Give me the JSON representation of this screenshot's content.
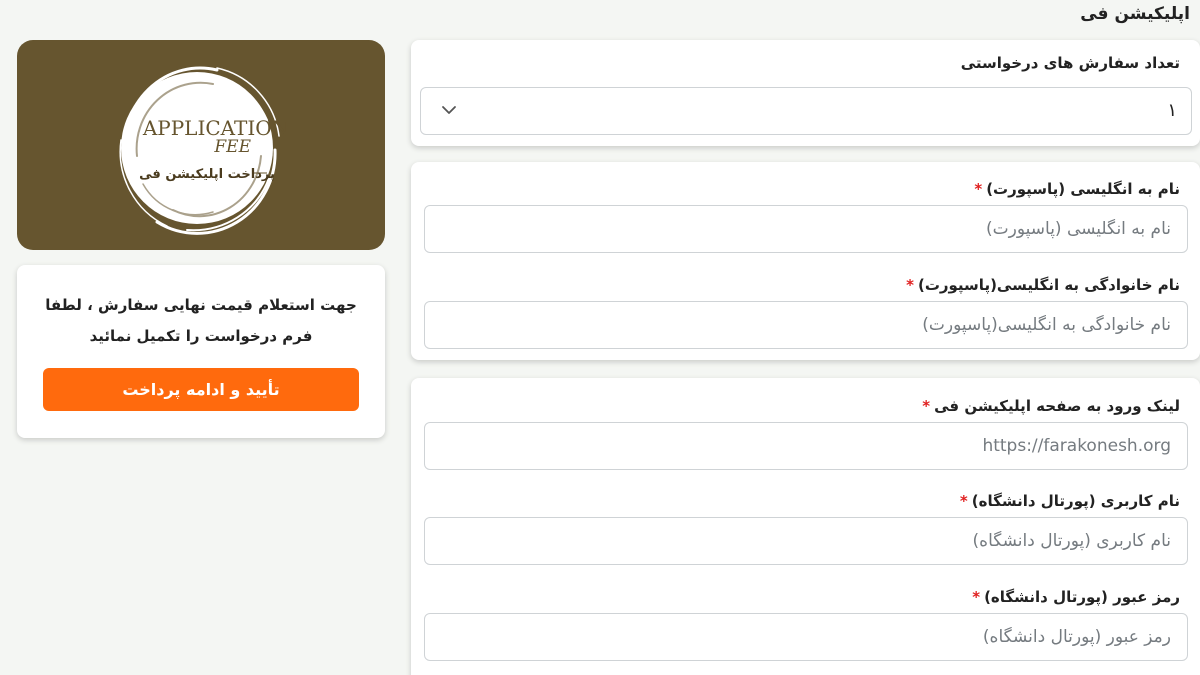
{
  "page": {
    "title": "اپلیکیشن فی"
  },
  "order": {
    "label": "تعداد سفارش های درخواستی",
    "value": "۱"
  },
  "names": {
    "first_label": "نام به انگلیسی (پاسپورت)",
    "first_placeholder": "نام به انگلیسی (پاسپورت)",
    "last_label": "نام خانوادگی به انگلیسی(پاسپورت)",
    "last_placeholder": "نام خانوادگی به انگلیسی(پاسپورت)"
  },
  "portal": {
    "link_label": "لینک ورود به صفحه اپلیکیشن فی",
    "link_placeholder": "https://farakonesh.org",
    "username_label": "نام کاربری (پورتال دانشگاه)",
    "username_placeholder": "نام کاربری (پورتال دانشگاه)",
    "password_label": "رمز عبور (پورتال دانشگاه)",
    "password_placeholder": "رمز عبور (پورتال دانشگاه)"
  },
  "required_mark": "*",
  "logo": {
    "line1": "APPLICATION",
    "line2": "FEE",
    "line3": "پرداخت اپلیکیشن فی"
  },
  "sidebar": {
    "info_text": "جهت استعلام قیمت نهایی سفارش ، لطفا فرم درخواست را تکمیل نمائید",
    "button_label": "تأیید و ادامه پرداخت"
  },
  "colors": {
    "accent": "#ff6a0d",
    "logo_background": "#66552f",
    "required": "#e02020"
  },
  "icons": {
    "select_arrow": "chevron-down-icon"
  }
}
